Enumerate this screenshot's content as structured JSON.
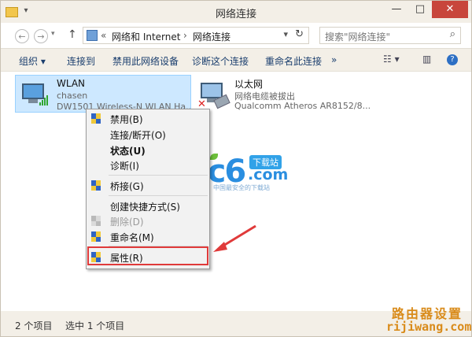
{
  "window": {
    "title": "网络连接",
    "controls": {
      "minimize": "—",
      "maximize": "□",
      "close": "✕"
    }
  },
  "nav": {
    "back": "←",
    "forward": "→",
    "up": "↑",
    "breadcrumb": {
      "chevrons": "«",
      "part1": "网络和 Internet",
      "sep": "›",
      "part2": "网络连接"
    },
    "refresh": "↻",
    "search_placeholder": "搜索\"网络连接\""
  },
  "toolbar": {
    "organize": "组织 ▾",
    "connect_to": "连接到",
    "disable_device": "禁用此网络设备",
    "diagnose": "诊断这个连接",
    "rename": "重命名此连接",
    "more": "»"
  },
  "connections": [
    {
      "name": "WLAN",
      "user": "chasen",
      "adapter": "DW1501 Wireless-N WLAN Ha..."
    },
    {
      "name": "以太网",
      "status": "网络电缆被拔出",
      "adapter": "Qualcomm Atheros AR8152/8..."
    }
  ],
  "context_menu": {
    "items": [
      {
        "label": "禁用(B)",
        "shield": true
      },
      {
        "label": "连接/断开(O)"
      },
      {
        "label": "状态(U)",
        "bold": true
      },
      {
        "label": "诊断(I)"
      },
      {
        "label": "桥接(G)",
        "shield": true
      },
      {
        "label": "创建快捷方式(S)"
      },
      {
        "label": "删除(D)",
        "shield": true,
        "disabled": true
      },
      {
        "label": "重命名(M)",
        "shield": true
      },
      {
        "label": "属性(R)",
        "shield": true,
        "highlighted": true
      }
    ]
  },
  "status": {
    "count": "2 个项目",
    "selected": "选中 1 个项目"
  },
  "watermarks": {
    "pc6_logo": "pc6",
    "pc6_badge": "下载站",
    "pc6_com": ".com",
    "pc6_tag": "中国最安全的下载站",
    "router_cn": "路由器设置",
    "router_url": "rijiwang.com"
  },
  "colors": {
    "selection": "#cde8ff",
    "highlight_box": "#e03a3a",
    "link": "#1a3e6e",
    "close": "#c8463c"
  }
}
